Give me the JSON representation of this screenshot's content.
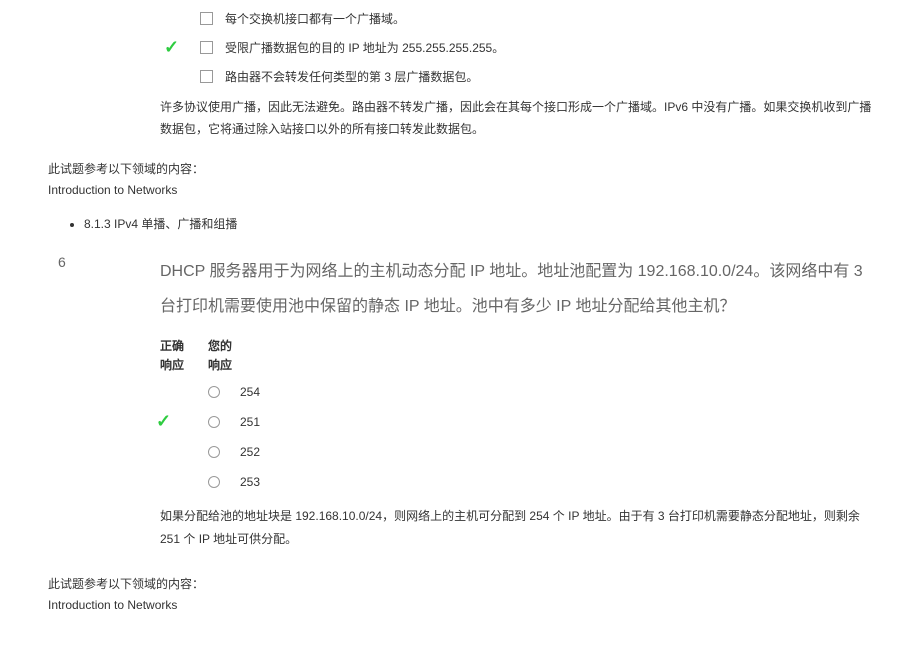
{
  "q5": {
    "options": [
      {
        "text": "每个交换机接口都有一个广播域。",
        "correct": false
      },
      {
        "text": "受限广播数据包的目的 IP 地址为 255.255.255.255。",
        "correct": true
      },
      {
        "text": "路由器不会转发任何类型的第 3 层广播数据包。",
        "correct": false
      }
    ],
    "explanation": "许多协议使用广播，因此无法避免。路由器不转发广播，因此会在其每个接口形成一个广播域。IPv6 中没有广播。如果交换机收到广播数据包，它将通过除入站接口以外的所有接口转发此数据包。"
  },
  "reference1": {
    "title": "此试题参考以下领域的内容：",
    "content": "Introduction to Networks",
    "bullet": "8.1.3 IPv4 单播、广播和组播"
  },
  "q6": {
    "number": "6",
    "text": "DHCP 服务器用于为网络上的主机动态分配 IP 地址。地址池配置为 192.168.10.0/24。该网络中有 3 台打印机需要使用池中保留的静态 IP 地址。池中有多少 IP 地址分配给其他主机？",
    "header1": "正确",
    "header2": "响应",
    "header3": "您的",
    "header4": "响应",
    "options": [
      {
        "text": "254",
        "correct": false
      },
      {
        "text": "251",
        "correct": true
      },
      {
        "text": "252",
        "correct": false
      },
      {
        "text": "253",
        "correct": false
      }
    ],
    "explanation": "如果分配给池的地址块是 192.168.10.0/24，则网络上的主机可分配到 254 个 IP 地址。由于有 3 台打印机需要静态分配地址，则剩余 251 个 IP 地址可供分配。"
  },
  "reference2": {
    "title": "此试题参考以下领域的内容：",
    "content": "Introduction to Networks"
  }
}
